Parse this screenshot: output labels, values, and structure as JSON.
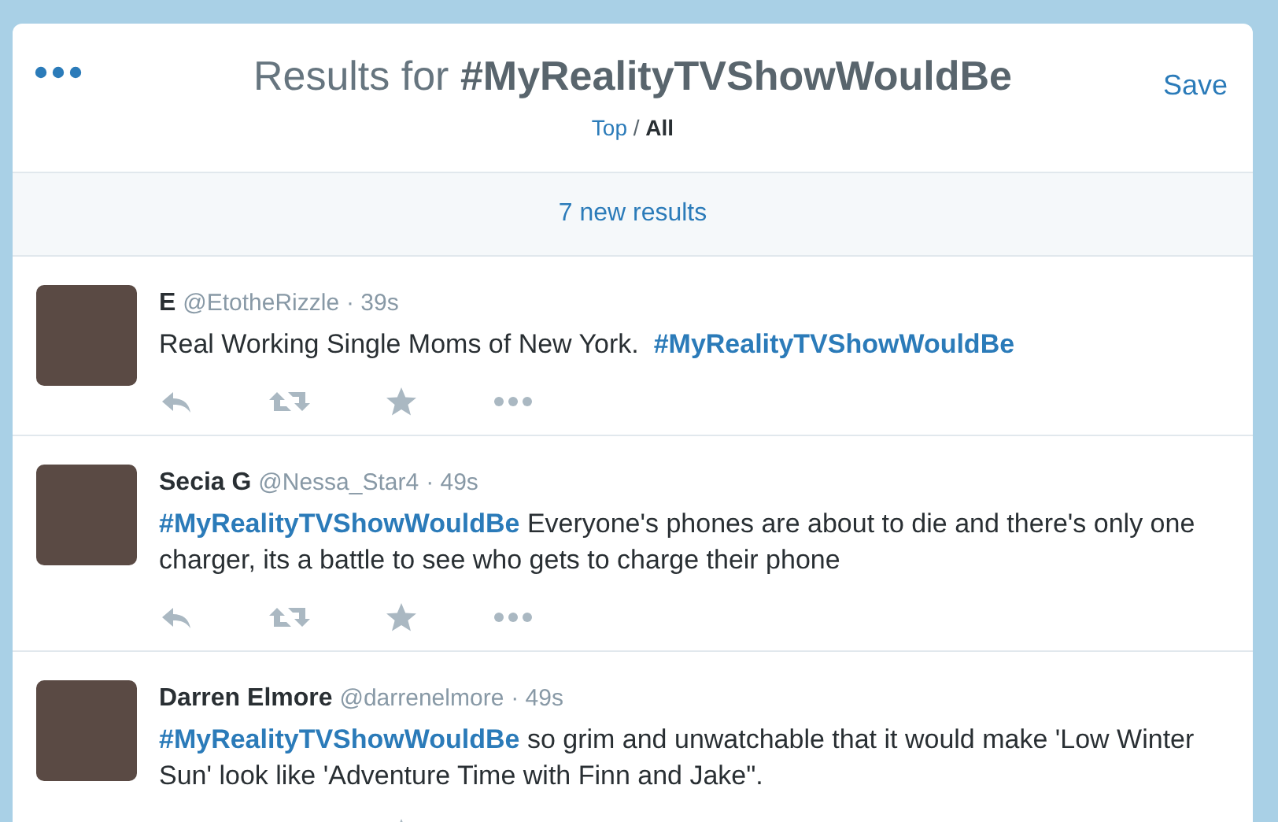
{
  "header": {
    "title": "Results for **#MyRealityTVShowWouldBe**",
    "save": "Save",
    "filters": [
      {
        "label": "Top",
        "selected": false
      },
      {
        "label": "All",
        "selected": true
      }
    ],
    "separator": "/"
  },
  "new_results": "7 new results",
  "tweets": [
    {
      "name": "E",
      "handle": "@EtotheRizzle",
      "time": "· 39s",
      "text": [
        {
          "kind": "text",
          "text": "Real Working Single Moms of New York.  "
        },
        {
          "kind": "hashtag",
          "text": "#MyRealityTVShowWouldBe"
        }
      ]
    },
    {
      "name": "Secia G",
      "handle": "@Nessa_Star4",
      "time": "· 49s",
      "text": [
        {
          "kind": "hashtag",
          "text": "#MyRealityTVShowWouldBe"
        },
        {
          "kind": "text",
          "text": " Everyone's phones are about to die and there's only one charger, its a battle to see who gets to charge their phone"
        }
      ]
    },
    {
      "name": "Darren Elmore",
      "handle": "@darrenelmore",
      "time": "· 49s",
      "text": [
        {
          "kind": "hashtag",
          "text": "#MyRealityTVShowWouldBe"
        },
        {
          "kind": "text",
          "text": " so grim and unwatchable that it would make 'Low Winter Sun' look like 'Adventure Time with Finn and Jake\"."
        }
      ]
    }
  ]
}
